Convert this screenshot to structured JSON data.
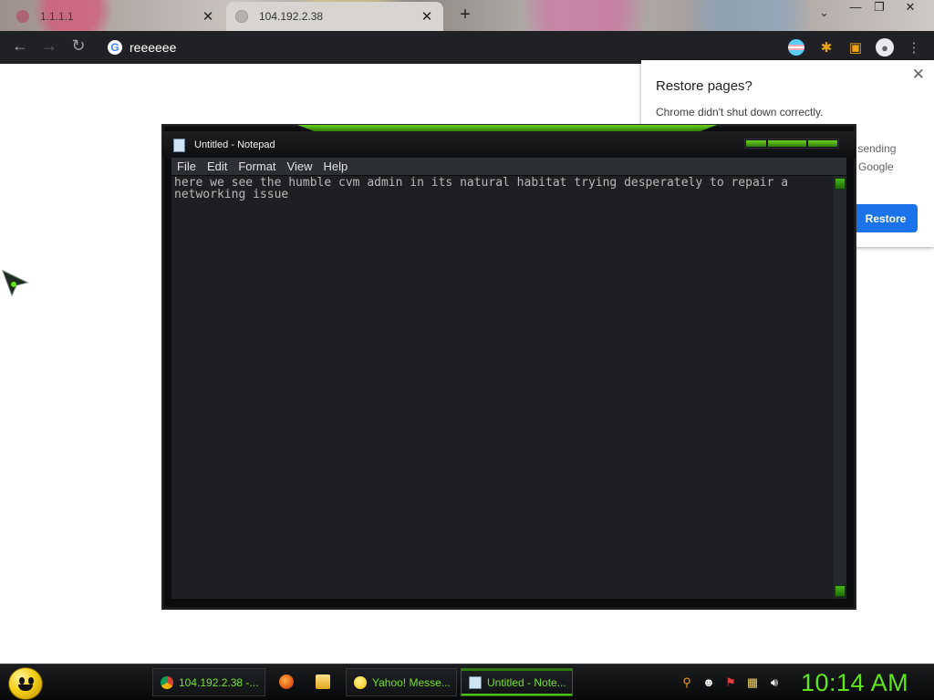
{
  "browser": {
    "tabs": [
      {
        "title": "1.1.1.1",
        "active": false
      },
      {
        "title": "104.192.2.38",
        "active": true
      }
    ],
    "new_tab_label": "+",
    "address_bar_text": "reeeeee"
  },
  "restore_popup": {
    "title": "Restore pages?",
    "message": "Chrome didn't shut down correctly.",
    "line1": "y sending",
    "line2": "Google",
    "restore_button": "Restore",
    "accent_color": "#1a73e8"
  },
  "notepad": {
    "title": "Untitled - Notepad",
    "menu": [
      "File",
      "Edit",
      "Format",
      "View",
      "Help"
    ],
    "content": "here we see the humble cvm admin in its natural habitat trying desperately to repair a networking issue",
    "accent_color": "#5fcf1a"
  },
  "taskbar": {
    "buttons": [
      {
        "label": "104.192.2.38 -...",
        "icon": "chrome-icon"
      },
      {
        "label": "Yahoo! Messe...",
        "icon": "yahoo-messenger-icon"
      },
      {
        "label": "Untitled - Note...",
        "icon": "notepad-icon"
      }
    ],
    "quick_launch": [
      "firefox-icon",
      "folder-icon"
    ],
    "tray_icons": [
      "search-icon",
      "messenger-status-icon",
      "flag-icon",
      "network-icon",
      "volume-icon"
    ],
    "clock": "10:14 AM"
  }
}
